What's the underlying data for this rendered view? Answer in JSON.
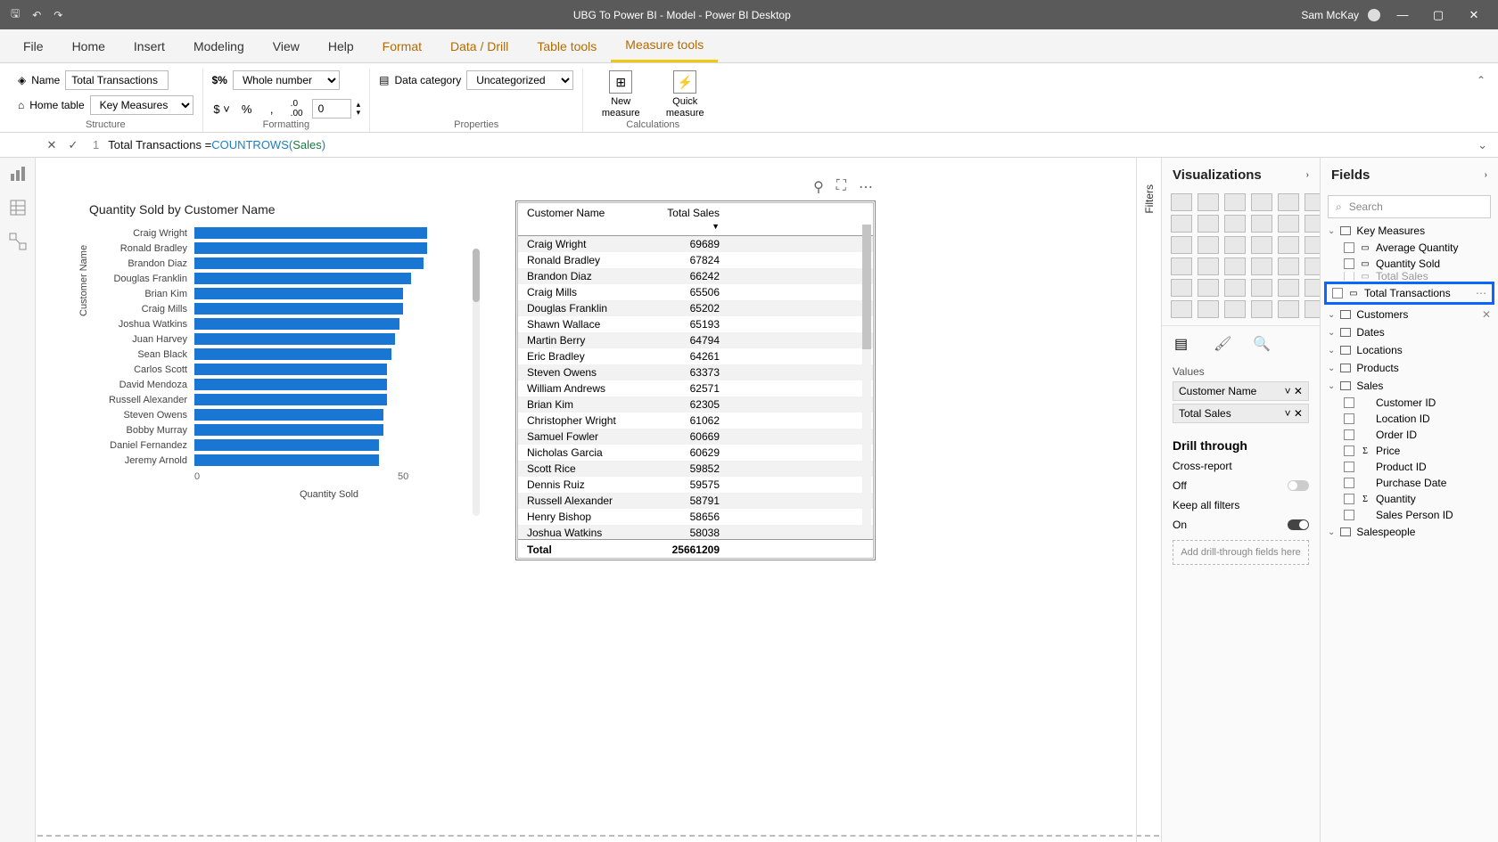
{
  "titlebar": {
    "title": "UBG To Power BI - Model - Power BI Desktop",
    "user": "Sam McKay"
  },
  "tabs": [
    "File",
    "Home",
    "Insert",
    "Modeling",
    "View",
    "Help",
    "Format",
    "Data / Drill",
    "Table tools",
    "Measure tools"
  ],
  "activeTab": 9,
  "ctxStart": 6,
  "ribbon": {
    "name_lbl": "Name",
    "name_val": "Total Transactions",
    "home_lbl": "Home table",
    "home_val": "Key Measures",
    "grp1": "Structure",
    "fmt_lbl": "Whole number",
    "dec_val": "0",
    "grp2": "Formatting",
    "cat_lbl": "Data category",
    "cat_val": "Uncategorized",
    "grp3": "Properties",
    "new_meas": "New measure",
    "quick_meas": "Quick measure",
    "grp4": "Calculations"
  },
  "formula": {
    "line": "1",
    "measure": "Total Transactions = ",
    "fn": "COUNTROWS(",
    "tbl": " Sales ",
    "close": ")"
  },
  "chart": {
    "title": "Quantity Sold by Customer Name",
    "ylabel": "Customer Name",
    "xlabel": "Quantity Sold",
    "ticks": [
      "0",
      "50"
    ]
  },
  "chart_data": {
    "type": "bar",
    "orientation": "horizontal",
    "xlim": [
      0,
      60
    ],
    "xlabel": "Quantity Sold",
    "ylabel": "Customer Name",
    "title": "Quantity Sold by Customer Name",
    "categories": [
      "Craig Wright",
      "Ronald Bradley",
      "Brandon Diaz",
      "Douglas Franklin",
      "Brian Kim",
      "Craig Mills",
      "Joshua Watkins",
      "Juan Harvey",
      "Sean Black",
      "Carlos Scott",
      "David Mendoza",
      "Russell Alexander",
      "Steven Owens",
      "Bobby Murray",
      "Daniel Fernandez",
      "Jeremy Arnold"
    ],
    "values": [
      58,
      58,
      57,
      54,
      52,
      52,
      51,
      50,
      49,
      48,
      48,
      48,
      47,
      47,
      46,
      46
    ]
  },
  "table": {
    "headers": [
      "Customer Name",
      "Total Sales"
    ],
    "rows": [
      [
        "Craig Wright",
        "69689"
      ],
      [
        "Ronald Bradley",
        "67824"
      ],
      [
        "Brandon Diaz",
        "66242"
      ],
      [
        "Craig Mills",
        "65506"
      ],
      [
        "Douglas Franklin",
        "65202"
      ],
      [
        "Shawn Wallace",
        "65193"
      ],
      [
        "Martin Berry",
        "64794"
      ],
      [
        "Eric Bradley",
        "64261"
      ],
      [
        "Steven Owens",
        "63373"
      ],
      [
        "William Andrews",
        "62571"
      ],
      [
        "Brian Kim",
        "62305"
      ],
      [
        "Christopher Wright",
        "61062"
      ],
      [
        "Samuel Fowler",
        "60669"
      ],
      [
        "Nicholas Garcia",
        "60629"
      ],
      [
        "Scott Rice",
        "59852"
      ],
      [
        "Dennis Ruiz",
        "59575"
      ],
      [
        "Russell Alexander",
        "58791"
      ],
      [
        "Henry Bishop",
        "58656"
      ],
      [
        "Joshua Watkins",
        "58038"
      ]
    ],
    "total_lbl": "Total",
    "total_val": "25661209"
  },
  "filters_label": "Filters",
  "viz": {
    "title": "Visualizations",
    "values_lbl": "Values",
    "val1": "Customer Name",
    "val2": "Total Sales",
    "drill": "Drill through",
    "cross": "Cross-report",
    "off": "Off",
    "keep": "Keep all filters",
    "on": "On",
    "drop": "Add drill-through fields here"
  },
  "fields": {
    "title": "Fields",
    "search": "Search",
    "groups": [
      {
        "name": "Key Measures",
        "open": true,
        "items": [
          {
            "t": "m",
            "n": "Average Quantity"
          },
          {
            "t": "m",
            "n": "Quantity Sold"
          },
          {
            "t": "m",
            "n": "Total Sales",
            "cut": true
          },
          {
            "t": "m",
            "n": "Total Transactions",
            "hl": true
          }
        ]
      },
      {
        "name": "Customers",
        "open": false,
        "x": true
      },
      {
        "name": "Dates",
        "open": false
      },
      {
        "name": "Locations",
        "open": false
      },
      {
        "name": "Products",
        "open": false
      },
      {
        "name": "Sales",
        "open": true,
        "items": [
          {
            "t": "f",
            "n": "Customer ID"
          },
          {
            "t": "f",
            "n": "Location ID"
          },
          {
            "t": "f",
            "n": "Order ID"
          },
          {
            "t": "s",
            "n": "Price"
          },
          {
            "t": "f",
            "n": "Product ID"
          },
          {
            "t": "f",
            "n": "Purchase Date"
          },
          {
            "t": "s",
            "n": "Quantity"
          },
          {
            "t": "f",
            "n": "Sales Person ID"
          }
        ]
      },
      {
        "name": "Salespeople",
        "open": false
      }
    ]
  }
}
